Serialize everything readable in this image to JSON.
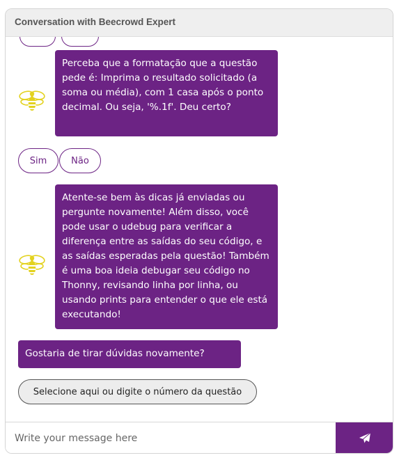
{
  "header": {
    "title": "Conversation with Beecrowd Expert"
  },
  "messages": [
    {
      "sender": "bot",
      "avatar_icon": "bee-icon",
      "text": "Perceba que a formatação que a questão pede é: Imprima o resultado solicitado (a soma ou média), com 1 casa após o ponto decimal. Ou seja, '%.1f'. Deu certo?"
    },
    {
      "sender": "bot",
      "avatar_icon": "bee-icon",
      "text": "Atente-se bem às dicas já enviadas ou pergunte novamente! Além disso, você pode usar o udebug para verificar a diferença entre as saídas do seu código, e as saídas esperadas pela questão! Também é uma boa ideia debugar seu código no Thonny, revisando linha por linha, ou usando prints para entender o que ele está executando!"
    },
    {
      "sender": "bot",
      "text": "Gostaria de tirar dúvidas novamente?"
    }
  ],
  "choices": {
    "yes_label": "Sim",
    "no_label": "Não"
  },
  "select_question_label": "Selecione aqui ou digite o número da questão",
  "input": {
    "placeholder": "Write your message here",
    "value": ""
  },
  "send_icon": "paper-plane-icon",
  "colors": {
    "accent": "#6c2384",
    "bee_yellow": "#e3d21f",
    "header_bg": "#efefef"
  }
}
